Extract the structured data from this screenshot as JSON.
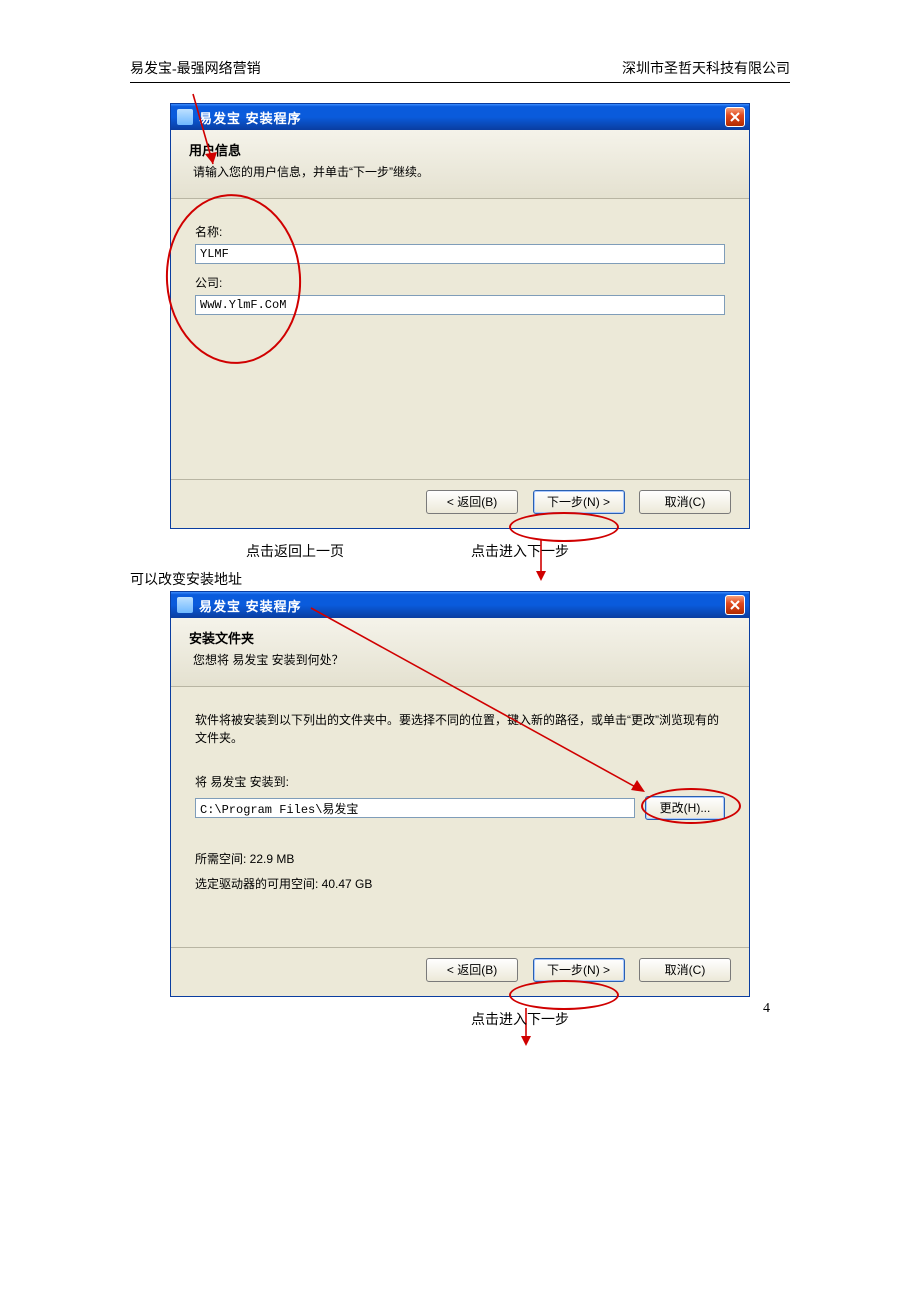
{
  "doc": {
    "header_left": "易发宝-最强网络营销",
    "header_right": "深圳市圣哲天科技有限公司",
    "page_number": "4"
  },
  "win1": {
    "title": "易发宝 安装程序",
    "header_title": "用户信息",
    "header_sub": "请输入您的用户信息，并单击“下一步”继续。",
    "name_label": "名称:",
    "name_value": "YLMF",
    "company_label": "公司:",
    "company_value": "WwW.YlmF.CoM",
    "back_btn": "< 返回(B)",
    "next_btn": "下一步(N) >",
    "cancel_btn": "取消(C)"
  },
  "annot1": {
    "back_hint": "点击返回上一页",
    "next_hint": "点击进入下一步",
    "change_addr": "可以改变安装地址"
  },
  "win2": {
    "title": "易发宝 安装程序",
    "header_title": "安装文件夹",
    "header_sub": "您想将 易发宝 安装到何处？",
    "body_text": "软件将被安装到以下列出的文件夹中。要选择不同的位置，键入新的路径，或单击“更改”浏览现有的文件夹。",
    "install_to_label": "将 易发宝 安装到:",
    "path_value": "C:\\Program Files\\易发宝",
    "change_btn": "更改(H)...",
    "space_required": "所需空间: 22.9 MB",
    "space_available": "选定驱动器的可用空间: 40.47 GB",
    "back_btn": "< 返回(B)",
    "next_btn": "下一步(N) >",
    "cancel_btn": "取消(C)"
  },
  "annot2": {
    "next_hint": "点击进入下一步"
  }
}
